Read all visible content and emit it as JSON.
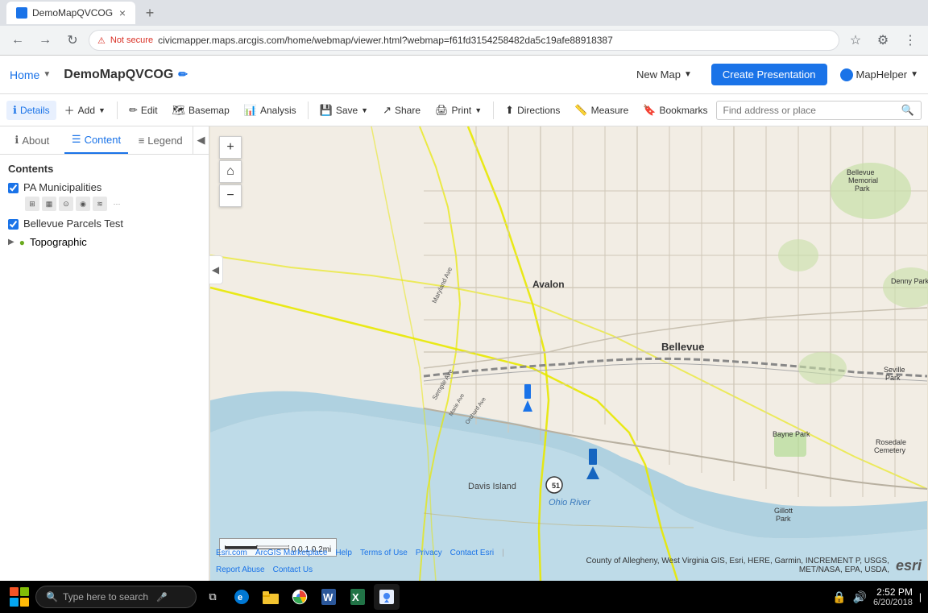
{
  "browser": {
    "tab_title": "DemoMapQVCOG",
    "url": "civicmapper.maps.arcgis.com/home/webmap/viewer.html?webmap=f61fd3154258482da5c19afe88918387",
    "security_label": "Not secure",
    "new_tab_label": "+",
    "back_title": "Back",
    "forward_title": "Forward",
    "refresh_title": "Refresh",
    "home_title": "Home"
  },
  "app_header": {
    "home_label": "Home",
    "map_title": "DemoMapQVCOG",
    "new_map_label": "New Map",
    "create_presentation_label": "Create Presentation",
    "maphelper_label": "MapHelper"
  },
  "toolbar": {
    "details_label": "Details",
    "add_label": "Add",
    "edit_label": "Edit",
    "basemap_label": "Basemap",
    "analysis_label": "Analysis",
    "save_label": "Save",
    "share_label": "Share",
    "print_label": "Print",
    "directions_label": "Directions",
    "measure_label": "Measure",
    "bookmarks_label": "Bookmarks",
    "search_placeholder": "Find address or place"
  },
  "sidebar": {
    "about_label": "About",
    "content_label": "Content",
    "legend_label": "Legend",
    "contents_header": "Contents",
    "layers": [
      {
        "name": "PA Municipalities",
        "checked": true,
        "has_tools": true
      },
      {
        "name": "Bellevue Parcels Test",
        "checked": true,
        "has_tools": false
      }
    ],
    "layer_group": "Topographic"
  },
  "map_controls": {
    "zoom_in": "+",
    "zoom_out": "−",
    "home": "⌂"
  },
  "scale": {
    "label": "0    0.1    0.2mi"
  },
  "attribution": {
    "links": [
      "Esri.com",
      "ArcGIS Marketplace",
      "Help",
      "Terms of Use",
      "Privacy",
      "Contact Esri",
      "Report Abuse",
      "Contact Us"
    ],
    "right_text": "County of Allegheny, West Virginia GIS, Esri, HERE, Garmin, INCREMENT P, USGS, MET/NASA, EPA, USDA,",
    "esri_label": "esri"
  },
  "taskbar": {
    "search_placeholder": "Type here to search",
    "time": "2:52 PM",
    "date": "6/20/2018"
  },
  "map_labels": [
    "Bellevue",
    "Avalon",
    "Davis Island",
    "Ohio River",
    "Denny Park",
    "Seville Park",
    "Rosedale Cemetery",
    "Bayne Park",
    "Gillott Park"
  ]
}
